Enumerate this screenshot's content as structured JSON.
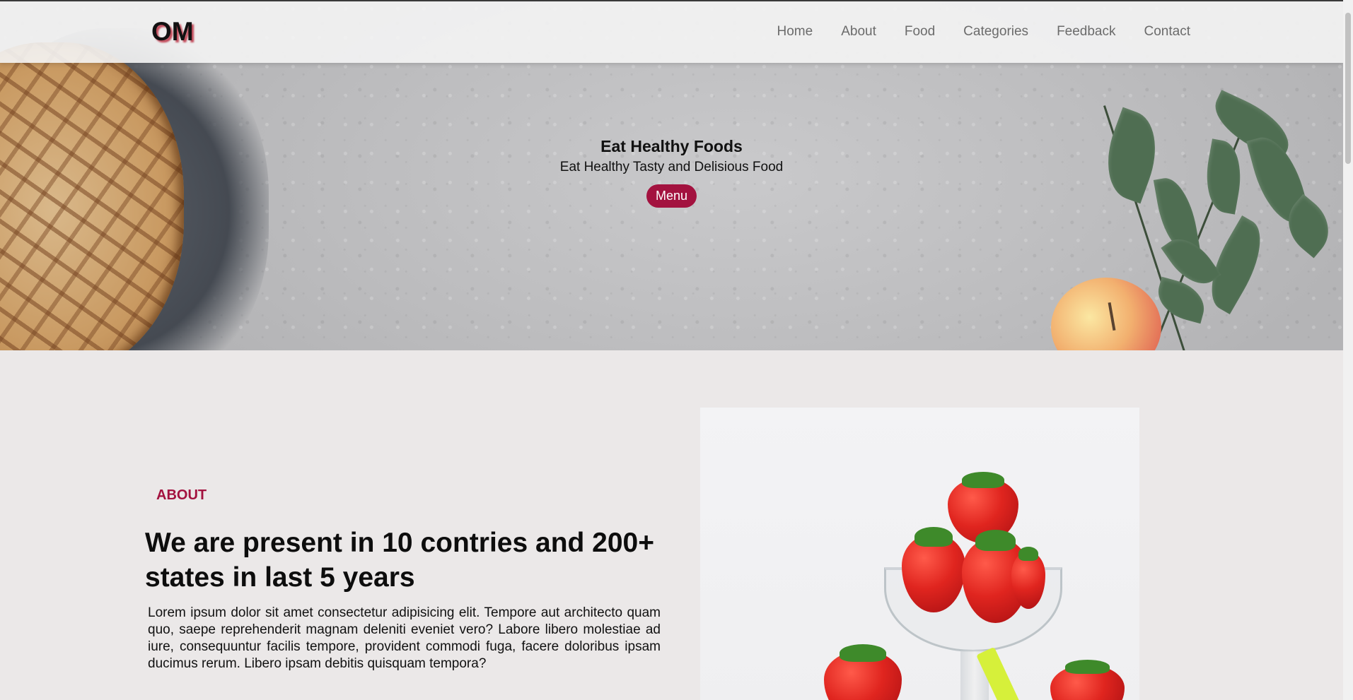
{
  "navbar": {
    "logo": "OM",
    "links": [
      "Home",
      "About",
      "Food",
      "Categories",
      "Feedback",
      "Contact"
    ]
  },
  "hero": {
    "title": "Eat Healthy Foods",
    "subtitle": "Eat Healthy Tasty and Delisious Food",
    "button_label": "Menu"
  },
  "about": {
    "tag": "ABOUT",
    "heading": "We are present in 10 contries and 200+ states in last 5 years",
    "text": "Lorem ipsum dolor sit amet consectetur adipisicing elit. Tempore aut architecto quam quo, saepe reprehenderit magnam deleniti eveniet vero? Labore libero molestiae ad iure, consequuntur facilis tempore, provident commodi fuga, facere doloribus ipsam ducimus rerum. Libero ipsam debitis quisquam tempora?"
  },
  "colors": {
    "accent": "#a3123f",
    "background": "#ebe8e8"
  }
}
